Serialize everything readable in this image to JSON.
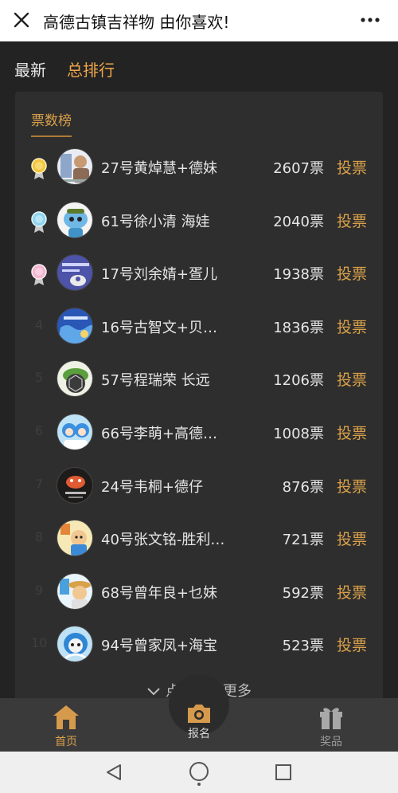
{
  "window": {
    "title": "高德古镇吉祥物 由你喜欢!"
  },
  "subnav": {
    "tabs": [
      {
        "label": "最新"
      },
      {
        "label": "总排行"
      }
    ]
  },
  "ranking": {
    "title": "票数榜",
    "vote_label": "投票",
    "rows": [
      {
        "rank": "1",
        "medal": "gold",
        "name": "27号黄焯慧+德妹",
        "votes": "2607票"
      },
      {
        "rank": "2",
        "medal": "blue",
        "name": "61号徐小清 海娃",
        "votes": "2040票"
      },
      {
        "rank": "3",
        "medal": "pink",
        "name": "17号刘余婧+疍儿",
        "votes": "1938票"
      },
      {
        "rank": "4",
        "medal": "",
        "name": "16号古智文+贝…",
        "votes": "1836票"
      },
      {
        "rank": "5",
        "medal": "",
        "name": "57号程瑞荣 长远",
        "votes": "1206票"
      },
      {
        "rank": "6",
        "medal": "",
        "name": "66号李萌+高德…",
        "votes": "1008票"
      },
      {
        "rank": "7",
        "medal": "",
        "name": "24号韦桐+德仔",
        "votes": "876票"
      },
      {
        "rank": "8",
        "medal": "",
        "name": "40号张文铭-胜利…",
        "votes": "721票"
      },
      {
        "rank": "9",
        "medal": "",
        "name": "68号曾年良+乜妹",
        "votes": "592票"
      },
      {
        "rank": "10",
        "medal": "",
        "name": "94号曾家凤+海宝",
        "votes": "523票"
      }
    ],
    "load_more": "点击加载更多"
  },
  "tabbar": {
    "home": "首页",
    "signup": "报名",
    "prize": "奖品"
  },
  "colors": {
    "accent": "#d9a04a",
    "background": "#232323",
    "card": "#2e2e2e"
  },
  "icons": {
    "close": "close-icon",
    "more": "more-dots-icon",
    "home": "home-icon",
    "signup": "camera-icon",
    "prize": "gift-icon",
    "back": "back-triangle-icon",
    "homebtn": "home-circle-icon",
    "recent": "recent-square-icon"
  }
}
